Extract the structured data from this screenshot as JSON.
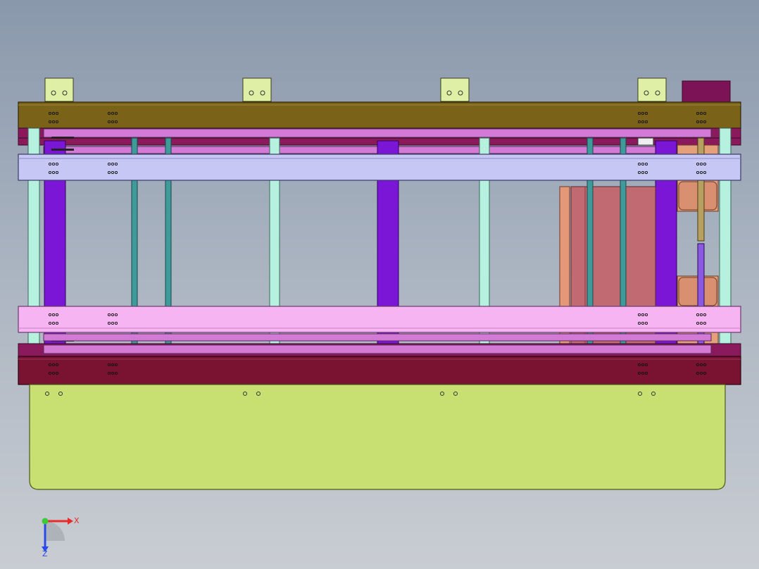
{
  "colors": {
    "background_top": "#8a98ac",
    "background_bottom": "#c9cdd3",
    "top_plate": "#7a6218",
    "stripper_plate": "#c6c7f4",
    "lower_stripper_plate": "#f6b4f2",
    "bottom_plate": "#7a1332",
    "die_shoe": "#c8df72",
    "guide_pillar": "#b6f0de",
    "spacer_block": "#7c16d6",
    "thin_rod": "#3f9a9a",
    "punch_block": "#c26a72",
    "magenta_block": "#7c1356"
  },
  "triad": {
    "x_label": "X",
    "z_label": "Z",
    "x_color": "#e82a2a",
    "y_color": "#3acb3a",
    "z_color": "#2a4ae8"
  }
}
